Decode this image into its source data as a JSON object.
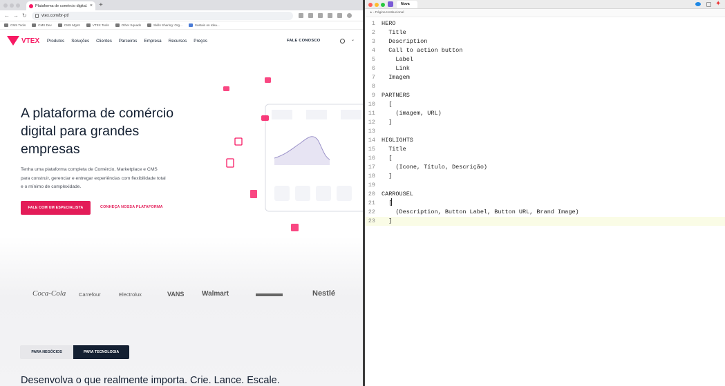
{
  "browser": {
    "tab_title": "Plataforma de comércio digital...",
    "url": "vtex.com/br-pt/",
    "bookmarks": [
      "CMS Tools",
      "CMS Dev",
      "CMS Mgmt",
      "VTEX Tools",
      "Other Squads",
      "Skills Sharing: Org...",
      "Sustain on Idea..."
    ]
  },
  "site": {
    "logo": "VTEX",
    "menu": [
      "Produtos",
      "Soluções",
      "Clientes",
      "Parceiros",
      "Empresa",
      "Recursos",
      "Preços"
    ],
    "contact": "FALE CONOSCO",
    "hero": {
      "title": "A plataforma de comércio digital para grandes empresas",
      "description": "Tenha uma plataforma completa de Comércio, Marketplace e CMS para construir, gerenciar e entregar experiências com flexibilidade total e o mínimo de complexidade.",
      "cta_primary": "FALE COM UM ESPECIALISTA",
      "cta_secondary": "CONHEÇA NOSSA PLATAFORMA"
    },
    "partners": [
      "Coca-Cola",
      "Carrefour",
      "Electrolux",
      "VANS",
      "Walmart",
      "",
      "Nestlé"
    ],
    "segment": {
      "business": "PARA NEGÓCIOS",
      "tech": "PARA TECNOLOGIA"
    },
    "bottom_headline": "Desenvolva o que realmente importa. Crie. Lance. Escale.",
    "accent": "#f71963"
  },
  "editor": {
    "doc_tab": "Nova",
    "breadcrumb": "Página Institucional",
    "lines": [
      "HERO",
      "  Title",
      "  Description",
      "  Call to action button",
      "    Label",
      "    Link",
      "  Imagem",
      "",
      "PARTNERS",
      "  [",
      "    (imagem, URL)",
      "  ]",
      "",
      "HIGLIGHTS",
      "  Title",
      "  [",
      "    (Icone, Título, Descrição)",
      "  ]",
      "",
      "CARROUSEL",
      "  [",
      "    (Description, Button Label, Button URL, Brand Image)",
      "  ]"
    ],
    "active_line": 23
  }
}
